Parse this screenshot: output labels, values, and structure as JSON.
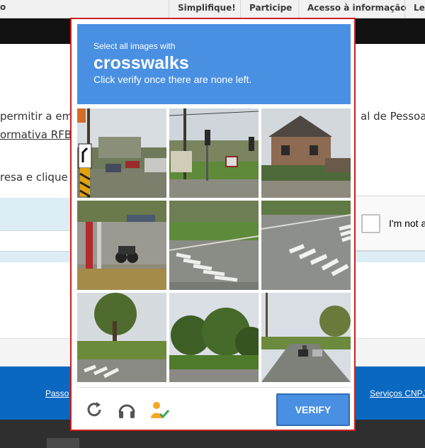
{
  "topbar": {
    "left_fragment": "o",
    "tabs": [
      "Simplifique!",
      "Participe",
      "Acesso à informação",
      "Le"
    ]
  },
  "content": {
    "line1_left": "permitir a emis",
    "line1_right": "al de Pessoa J",
    "line2": "ormativa RFB n",
    "line3": "resa e clique e"
  },
  "recaptcha_widget": {
    "label": "I'm not a"
  },
  "footer": {
    "link_left": "Passo",
    "link_right": "Serviços CNPJ"
  },
  "captcha": {
    "instruction_line1": "Select all images with",
    "target": "crosswalks",
    "instruction_line3": "Click verify once there are none left.",
    "tiles": [
      "street-with-sign-tile",
      "intersection-traffic-light-tile",
      "brick-house-tile",
      "gas-station-motorcycle-tile",
      "road-crosswalk-tile",
      "crosswalk-closeup-tile",
      "park-crosswalk-tile",
      "trees-road-tile",
      "street-cars-tile"
    ],
    "verify_label": "VERIFY",
    "icons": [
      "reload-icon",
      "audio-headphones-icon",
      "info-person-check-icon"
    ],
    "colors": {
      "header_blue": "#4a90e2",
      "border_red": "#cc1f1f",
      "footer_blue": "#0b68c1"
    }
  }
}
